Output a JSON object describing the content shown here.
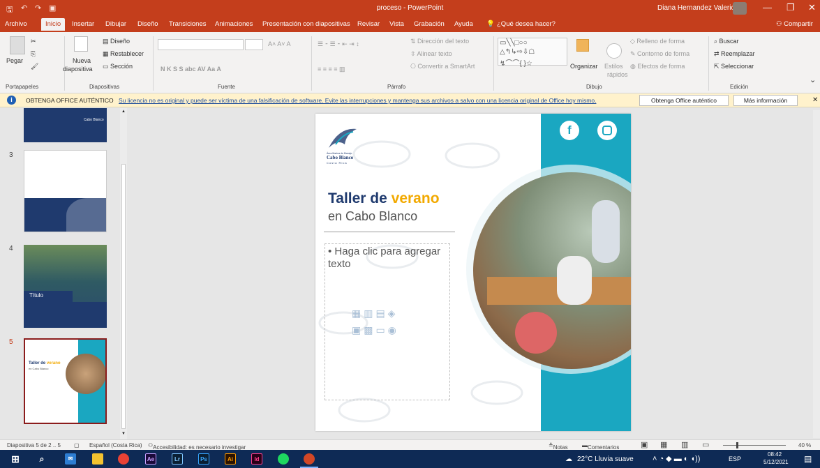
{
  "window": {
    "title": "proceso - PowerPoint",
    "user": "Diana Hernandez Valerio"
  },
  "tabs": [
    "Archivo",
    "Inicio",
    "Insertar",
    "Dibujar",
    "Diseño",
    "Transiciones",
    "Animaciones",
    "Presentación con diapositivas",
    "Revisar",
    "Vista",
    "Grabación",
    "Ayuda"
  ],
  "tell_me": "¿Qué desea hacer?",
  "share": "Compartir",
  "ribbon": {
    "pegar": "Pegar",
    "portapapeles": "Portapapeles",
    "nueva": "Nueva",
    "diapositiva": "diapositiva",
    "diseno": "Diseño",
    "restablecer": "Restablecer",
    "seccion": "Sección",
    "diapositivas": "Diapositivas",
    "fuente": "Fuente",
    "parrafo": "Párrafo",
    "direccion": "Dirección del texto",
    "alinear": "Alinear texto",
    "convertir": "Convertir a SmartArt",
    "organizar": "Organizar",
    "estilos": "Estilos",
    "rapidos": "rápidos",
    "relleno": "Relleno de forma",
    "contorno": "Contorno de forma",
    "efectos": "Efectos de forma",
    "dibujo": "Dibujo",
    "buscar": "Buscar",
    "reemplazar": "Reemplazar",
    "seleccionar": "Seleccionar",
    "edicion": "Edición",
    "font_tools": "N  K  S  S  abc  AV  Aa  A"
  },
  "notification": {
    "heading": "OBTENGA OFFICE AUTÉNTICO",
    "message": "Su licencia no es original y puede ser víctima de una falsificación de software. Evite las interrupciones y mantenga sus archivos a salvo con una licencia original de Office hoy mismo.",
    "btn1": "Obtenga Office auténtico",
    "btn2": "Más información"
  },
  "thumbs": {
    "n3": "3",
    "n4": "4",
    "n5": "5",
    "titulo": "Título",
    "t5title": "Taller de",
    "t5accent": "verano",
    "t5sub": "en Cabo Blanco",
    "logo_text": "Cabo Blanco"
  },
  "slide": {
    "logo_small": "Área Marina de Manejo",
    "logo_name": "Cabo Blanco",
    "logo_region": "Costa Rica",
    "title": "Taller de",
    "title_accent": "verano",
    "subtitle": "en Cabo Blanco",
    "placeholder": "Haga clic para agregar texto"
  },
  "status": {
    "slide": "Diapositiva 5 de 2 .. 5",
    "lang": "Español (Costa Rica)",
    "access": "Accesibilidad: es necesario investigar",
    "notas": "Notas",
    "comentarios": "Comentarios",
    "zoom": "40 %"
  },
  "taskbar": {
    "weather": "22°C  Lluvia suave",
    "lang": "ESP",
    "time": "08:42",
    "date": "5/12/2021",
    "apps": [
      "Ae",
      "Lr",
      "Ps",
      "Ai",
      "Id"
    ]
  },
  "colors": {
    "accent": "#c43e1c",
    "teal": "#1aa7c1",
    "navy": "#1f3a6e",
    "gold": "#f2a900"
  }
}
